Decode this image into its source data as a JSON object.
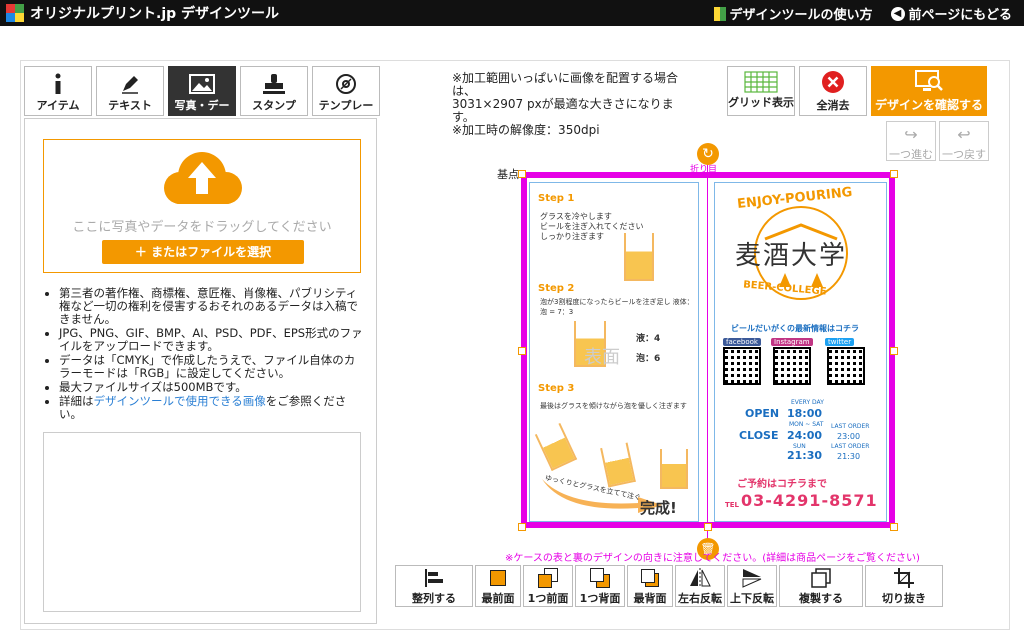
{
  "header": {
    "logo_text": "オリジナルプリント.jp デザインツール",
    "help_link": "デザインツールの使い方",
    "back_link": "前ページにもどる"
  },
  "tabs": [
    {
      "label": "アイテム",
      "icon": "info-icon"
    },
    {
      "label": "テキスト",
      "icon": "pen-icon"
    },
    {
      "label": "写真・デー",
      "icon": "image-icon"
    },
    {
      "label": "スタンプ",
      "icon": "stamp-icon"
    },
    {
      "label": "テンプレー",
      "icon": "disc-icon"
    }
  ],
  "upload": {
    "drop_text": "ここに写真やデータをドラッグしてください",
    "file_button": "＋ またはファイルを選択",
    "notes": [
      "第三者の著作権、商標権、意匠権、肖像権、パブリシティ権など一切の権利を侵害するおそれのあるデータは入稿できません。",
      "JPG、PNG、GIF、BMP、AI、PSD、PDF、EPS形式のファイルをアップロードできます。",
      "データは「CMYK」で作成したうえで、ファイル自体のカラーモードは「RGB」に設定してください。",
      "最大ファイルサイズは500MBです。"
    ],
    "note_link_prefix": "詳細は",
    "note_link": "デザインツールで使用できる画像",
    "note_link_suffix": "をご参照ください。"
  },
  "info": {
    "line1": "※加工範囲いっぱいに画像を配置する場合は、",
    "line2": "3031×2907 pxが最適な大きさになります。",
    "line3": "※加工時の解像度：350dpi"
  },
  "toolbar": {
    "grid_label": "グリッド表示",
    "clear_label": "全消去",
    "confirm_label": "デザインを確認する",
    "redo_label": "一つ進む",
    "undo_label": "一つ戻す"
  },
  "canvas": {
    "origin_label": "基点",
    "fold_label": "折り目",
    "left_page": {
      "step1": "Step 1",
      "step1_text_a": "グラスを冷やします",
      "step1_text_b": "ビールを注ぎ入れてください",
      "step1_text_c": "しっかり注ぎます",
      "step2": "Step 2",
      "step2_text": "泡が3割程度になったらビールを注ぎ足し 液体：泡 = 7：3",
      "ratio_label_a": "液：4",
      "ratio_label_b": "泡：6",
      "step3": "Step 3",
      "step3_text": "最後はグラスを傾けながら泡を優しく注ぎます",
      "finish_arc": "ゆっくりとグラスを立てて注ぐ",
      "finish": "完成!"
    },
    "right_page": {
      "arc_top": "ENJOY-POURING",
      "kanji": "麦酒大学",
      "arc_bottom": "BEER-COLLEGE",
      "sns_heading": "ビールだいがくの最新情報はコチラ",
      "badge_fb": "facebook",
      "badge_ig": "Instagram",
      "badge_tw": "twitter",
      "open_label": "OPEN",
      "open_time": "18:00",
      "open_note": "EVERY DAY",
      "close_label": "CLOSE",
      "close_time_a": "24:00",
      "close_time_b": "21:30",
      "close_note_a": "MON ~ SAT",
      "close_note_b": "SUN",
      "last_order_a": "LAST ORDER",
      "last_order_a_time": "23:00",
      "last_order_b": "LAST ORDER",
      "last_order_b_time": "21:30",
      "reserve": "ご予約はコチラまで",
      "tel_prefix": "TEL",
      "tel": "03-4291-8571"
    },
    "watermark": "表面"
  },
  "warning": "※ケースの表と裏のデザインの向きに注意してください。(詳細は商品ページをご覧ください)",
  "bottom_tools": [
    {
      "label": "整列する",
      "icon": "align-icon"
    },
    {
      "label": "最前面",
      "icon": "bring-front-icon"
    },
    {
      "label": "1つ前面",
      "icon": "bring-forward-icon"
    },
    {
      "label": "1つ背面",
      "icon": "send-backward-icon"
    },
    {
      "label": "最背面",
      "icon": "send-back-icon"
    },
    {
      "label": "左右反転",
      "icon": "flip-horizontal-icon"
    },
    {
      "label": "上下反転",
      "icon": "flip-vertical-icon"
    },
    {
      "label": "複製する",
      "icon": "duplicate-icon"
    },
    {
      "label": "切り抜き",
      "icon": "crop-icon"
    }
  ],
  "colors": {
    "accent": "#f39800",
    "frame": "#e600e6",
    "header_bg": "#111111"
  }
}
